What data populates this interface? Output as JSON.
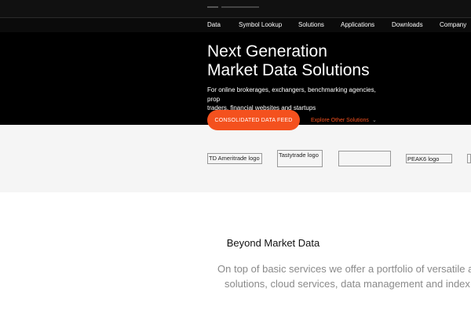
{
  "nav": {
    "items": [
      "Data",
      "Symbol Lookup",
      "Solutions",
      "Applications",
      "Downloads",
      "Company"
    ]
  },
  "hero": {
    "title_line1": "Next Generation",
    "title_line2": "Market Data Solutions",
    "subtitle_line1": "For online brokerages, exchangers, benchmarking agencies, prop",
    "subtitle_line2": "traders, financial websites and startups",
    "primary_cta": "CONSOLIDATED DATA FEED",
    "secondary_cta": "Explore Other Solutions"
  },
  "logos": {
    "items": [
      "TD Ameritrade logo",
      "Tastytrade logo",
      "",
      "PEAK6 logo"
    ]
  },
  "section": {
    "title": "Beyond Market Data",
    "body_line1": "On top of basic services we offer a portfolio of versatile an",
    "body_line2": "solutions, cloud services, data management and index m"
  },
  "colors": {
    "accent": "#f4511e",
    "hero_bg": "#000000",
    "logos_bg": "#f5f5f5"
  },
  "icons": {
    "explore": "chevron-down-icon"
  }
}
